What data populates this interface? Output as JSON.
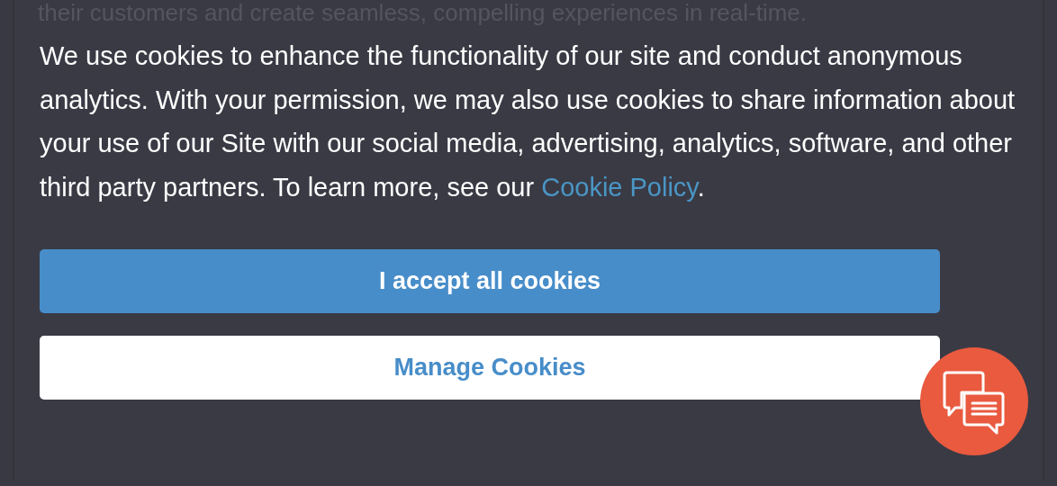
{
  "page": {
    "intro_line": "their customers and create seamless, compelling experiences in real-time."
  },
  "cookie_banner": {
    "message": "We use cookies to enhance the functionality of our site and conduct anonymous analytics. With your permission, we may also use cookies to share information about your use of our Site with our social media, advertising, analytics, software, and other third party partners. To learn more, see our",
    "link": "Cookie Policy",
    "after_link": ".",
    "buttons": [
      {
        "label": "I accept all cookies",
        "kind": "primary"
      },
      {
        "label": "Manage Cookies",
        "kind": "secondary"
      }
    ]
  },
  "chat_launcher": {
    "kind": "chat"
  }
}
